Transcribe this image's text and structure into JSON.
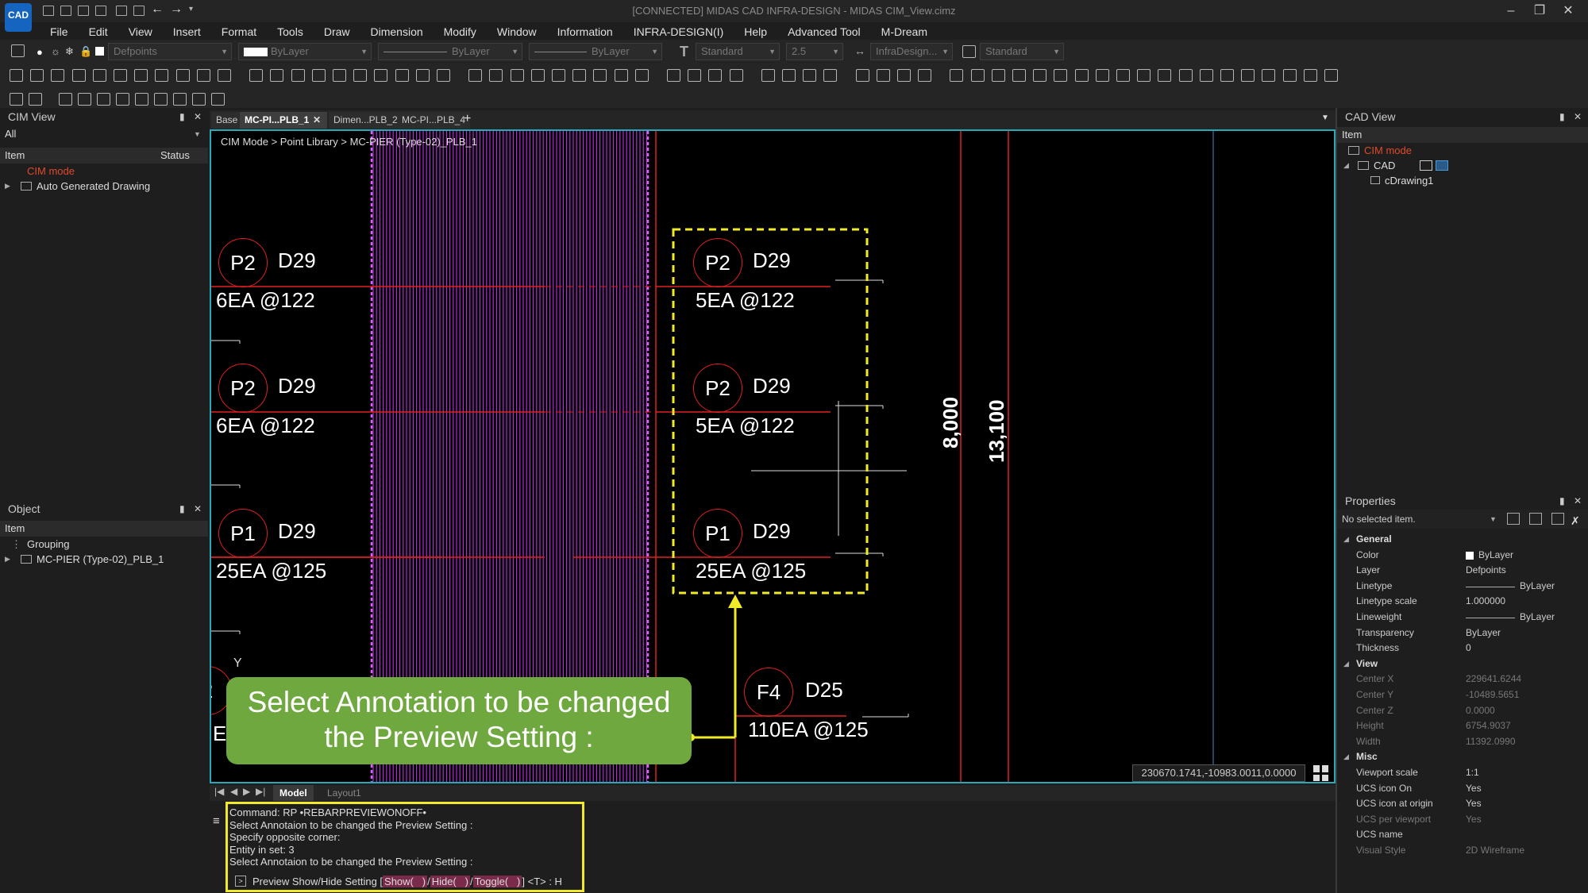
{
  "window": {
    "title": "[CONNECTED] MIDAS CAD INFRA-DESIGN - MIDAS CIM_View.cimz",
    "logo": "CAD",
    "controls": [
      "minimize-icon",
      "restore-icon",
      "close-icon"
    ]
  },
  "menu": [
    "File",
    "Edit",
    "View",
    "Insert",
    "Format",
    "Tools",
    "Draw",
    "Dimension",
    "Modify",
    "Window",
    "Information",
    "INFRA-DESIGN(I)",
    "Help",
    "Advanced Tool",
    "M-Dream"
  ],
  "props_toolbar": {
    "layer": "Defpoints",
    "color": "ByLayer",
    "linetype": "ByLayer",
    "lineweight": "ByLayer",
    "textstyle": "Standard",
    "textheight": "2.5",
    "dimstyle": "InfraDesign...",
    "tablestyle": "Standard"
  },
  "cim_view": {
    "title": "CIM View",
    "filter": "All",
    "col_item": "Item",
    "col_status": "Status",
    "items": [
      "CIM mode",
      "Auto Generated Drawing"
    ]
  },
  "object_panel": {
    "title": "Object",
    "col_item": "Item",
    "items": [
      "Grouping",
      "MC-PIER (Type-02)_PLB_1"
    ]
  },
  "doc_tabs": [
    "Base",
    "MC-PI...PLB_1",
    "Dimen...PLB_2",
    "MC-PI...PLB_4"
  ],
  "breadcrumb": "CIM Mode > Point Library > MC-PIER (Type-02)_PLB_1",
  "drawing": {
    "left_annotations": [
      {
        "circle": "P2",
        "dia": "D29",
        "spacing": "6EA @122"
      },
      {
        "circle": "P2",
        "dia": "D29",
        "spacing": "6EA @122"
      },
      {
        "circle": "P1",
        "dia": "D29",
        "spacing": "25EA @125"
      }
    ],
    "right_annotations": [
      {
        "circle": "P2",
        "dia": "D29",
        "spacing": "5EA @122"
      },
      {
        "circle": "P2",
        "dia": "D29",
        "spacing": "5EA @122"
      },
      {
        "circle": "P1",
        "dia": "D29",
        "spacing": "25EA @125"
      }
    ],
    "bottom_annotation": {
      "circle": "F4",
      "dia": "D25",
      "spacing": "110EA @125"
    },
    "partial_left_circle": "2",
    "partial_left_text": "E",
    "dim1": "8,000",
    "dim2": "13,100",
    "ucs_y": "Y",
    "coords": "230670.1741,-10983.0011,0.0000"
  },
  "callout_text": "Select Annotation to be changed the Preview Setting :",
  "layout_tabs": [
    "Model",
    "Layout1"
  ],
  "command_lines": [
    "Command:  RP •REBARPREVIEWONOFF•",
    "Select Annotaion to be changed the Preview Setting :",
    "Specify opposite corner:",
    "Entity in set: 3",
    "Select Annotaion to be changed the Preview Setting :"
  ],
  "command_prompt": {
    "prefix": "Preview Show/Hide Setting [",
    "opt1": "Show(",
    "opt2": "Hide(",
    "opt3": "Toggle(",
    "suffix": "] <T> : H"
  },
  "cad_view": {
    "title": "CAD View",
    "col_item": "Item",
    "items": [
      "CIM mode",
      "CAD",
      "cDrawing1"
    ]
  },
  "properties": {
    "title": "Properties",
    "selection": "No selected item.",
    "rows": [
      {
        "k": "General",
        "v": "",
        "type": "sec"
      },
      {
        "k": "Color",
        "v": "ByLayer",
        "type": "color"
      },
      {
        "k": "Layer",
        "v": "Defpoints",
        "type": ""
      },
      {
        "k": "Linetype",
        "v": "ByLayer",
        "type": "line"
      },
      {
        "k": "Linetype scale",
        "v": "1.000000",
        "type": ""
      },
      {
        "k": "Lineweight",
        "v": "ByLayer",
        "type": "line"
      },
      {
        "k": "Transparency",
        "v": "ByLayer",
        "type": ""
      },
      {
        "k": "Thickness",
        "v": "0",
        "type": ""
      },
      {
        "k": "View",
        "v": "",
        "type": "sec"
      },
      {
        "k": "Center X",
        "v": "229641.6244",
        "type": "dim"
      },
      {
        "k": "Center Y",
        "v": "-10489.5651",
        "type": "dim"
      },
      {
        "k": "Center Z",
        "v": "0.0000",
        "type": "dim"
      },
      {
        "k": "Height",
        "v": "6754.9037",
        "type": "dim"
      },
      {
        "k": "Width",
        "v": "11392.0990",
        "type": "dim"
      },
      {
        "k": "Misc",
        "v": "",
        "type": "sec"
      },
      {
        "k": "Viewport scale",
        "v": "1:1",
        "type": ""
      },
      {
        "k": "UCS icon On",
        "v": "Yes",
        "type": ""
      },
      {
        "k": "UCS icon at origin",
        "v": "Yes",
        "type": ""
      },
      {
        "k": "UCS per viewport",
        "v": "Yes",
        "type": "dim"
      },
      {
        "k": "UCS name",
        "v": "",
        "type": ""
      },
      {
        "k": "Visual Style",
        "v": "2D Wireframe",
        "type": "dim"
      }
    ]
  },
  "colors": {
    "accent": "#2aa8b8",
    "highlight": "#f0ea2a",
    "callout": "#6ea83f",
    "cim_mode": "#e04a2a",
    "rebar_red": "#e02020",
    "magenta": "#c040e0"
  }
}
